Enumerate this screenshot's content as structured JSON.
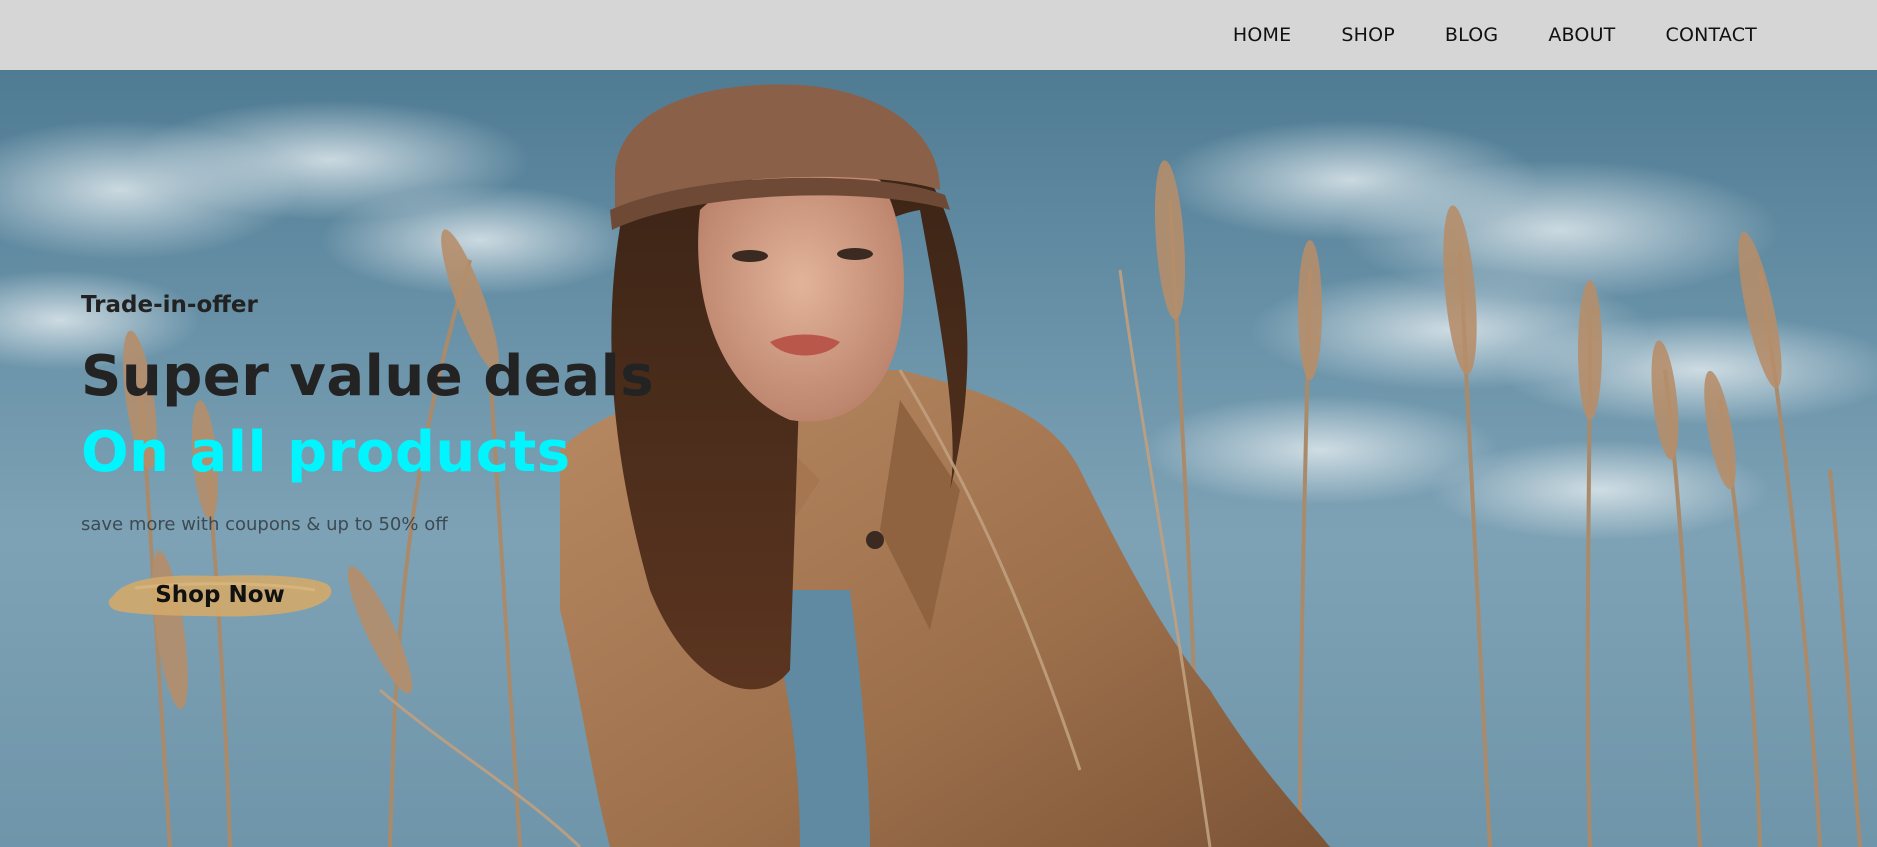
{
  "nav": {
    "items": [
      {
        "label": "HOME"
      },
      {
        "label": "SHOP"
      },
      {
        "label": "BLOG"
      },
      {
        "label": "ABOUT"
      },
      {
        "label": "CONTACT"
      }
    ]
  },
  "hero": {
    "eyebrow": "Trade-in-offer",
    "headline_line1": "Super value deals",
    "headline_line2": "On all products",
    "subtext": "save more with coupons & up to 50% off",
    "cta_label": "Shop Now"
  },
  "colors": {
    "nav_bg": "#d6d6d6",
    "accent_cyan": "#00f5ff",
    "headline_dark": "#232323",
    "cta_brush": "#d1a86a"
  }
}
